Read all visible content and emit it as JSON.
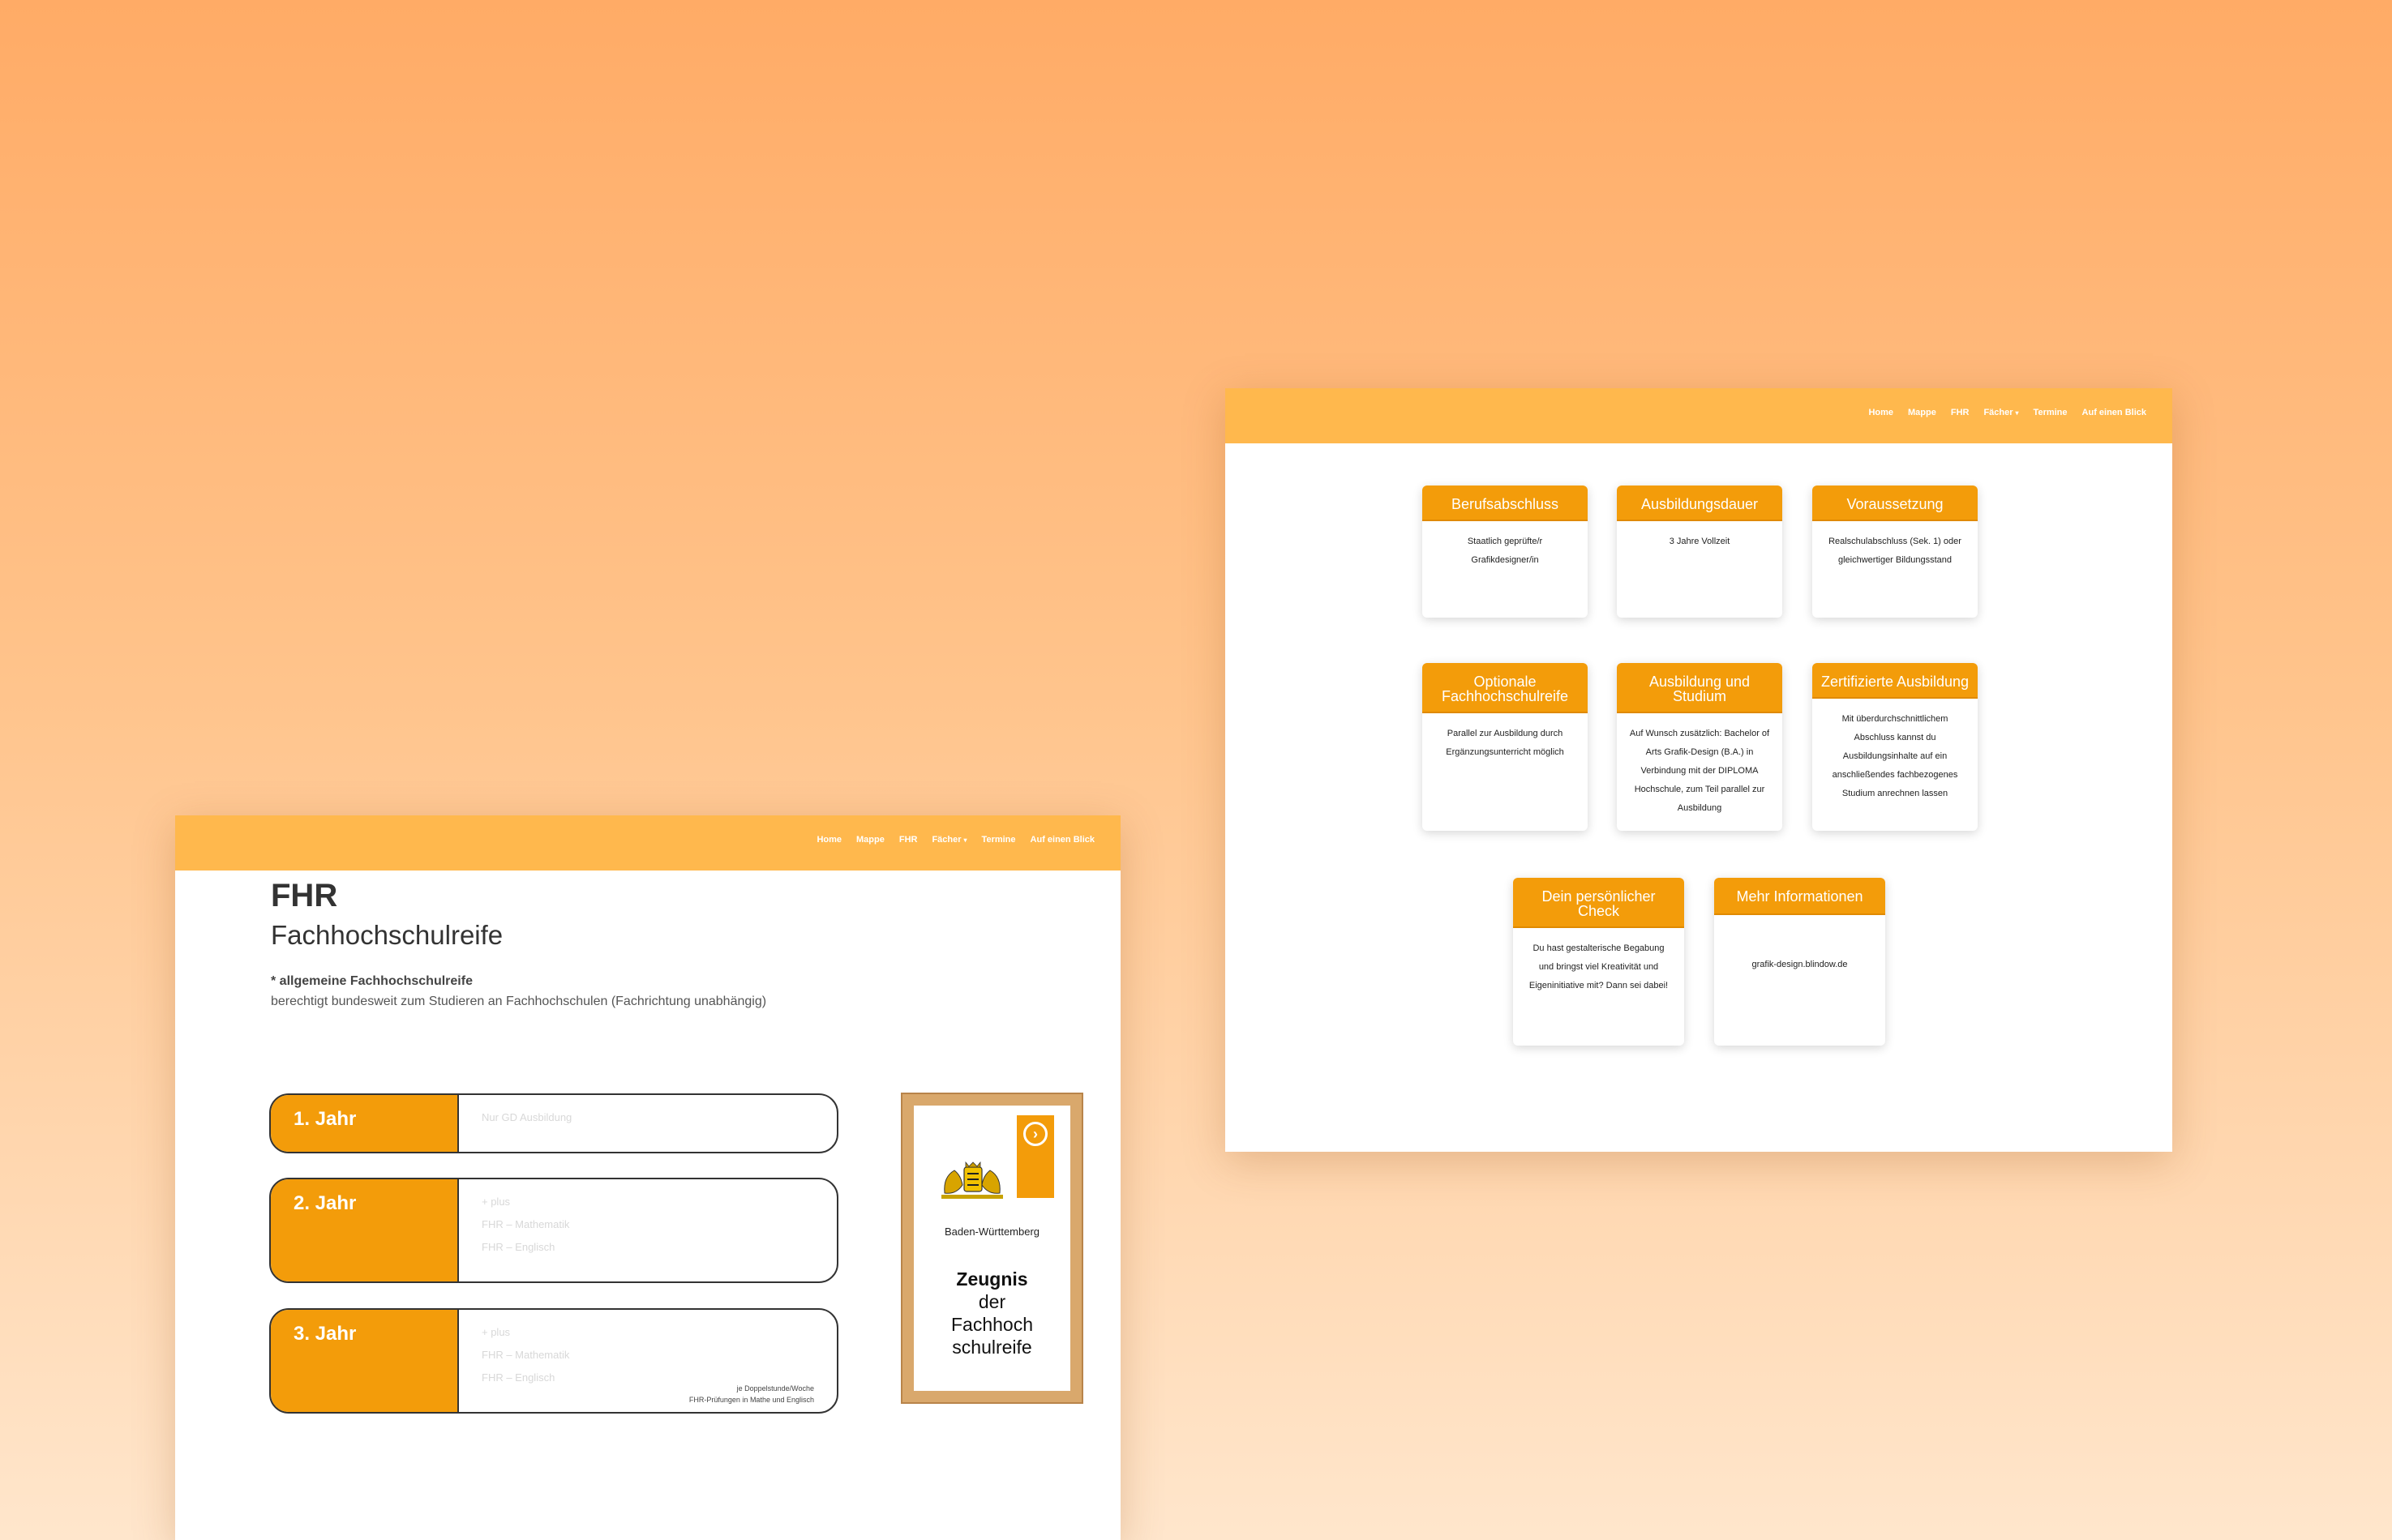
{
  "nav": {
    "items": [
      "Home",
      "Mappe",
      "FHR",
      "Fächer",
      "Termine",
      "Auf einen Blick"
    ],
    "dropdown_caret": "chevron-down"
  },
  "overview_page": {
    "cards": [
      {
        "title": "Berufsabschluss",
        "body": "Staatlich geprüfte/r Grafikdesigner/in"
      },
      {
        "title": "Ausbildungsdauer",
        "body": "3 Jahre Vollzeit"
      },
      {
        "title": "Voraussetzung",
        "body": "Realschulabschluss (Sek. 1) oder gleichwertiger Bildungsstand"
      },
      {
        "title": "Optionale Fachhochschulreife",
        "body": "Parallel zur Ausbildung durch Ergänzungsunterricht möglich"
      },
      {
        "title": "Ausbildung und Studium",
        "body": "Auf Wunsch zusätzlich: Bachelor of Arts Grafik-Design (B.A.) in Verbindung mit der DIPLOMA Hochschule, zum Teil parallel zur Ausbildung"
      },
      {
        "title": "Zertifizierte Ausbildung",
        "body": "Mit überdurchschnittlichem Abschluss kannst du Ausbildungsinhalte auf ein anschließendes fachbezogenes Studium anrechnen lassen"
      },
      {
        "title": "Dein persönlicher Check",
        "body": "Du hast gestalterische Begabung und bringst viel Kreativität und Eigeninitiative mit? Dann sei dabei!"
      },
      {
        "title": "Mehr Informationen",
        "body": "grafik-design.blindow.de"
      }
    ]
  },
  "fhr_page": {
    "title": "FHR",
    "subtitle": "Fachhochschulreife",
    "note": "* allgemeine Fachhochschulreife",
    "description": "berechtigt bundesweit zum Studieren an Fachhochschulen (Fachrichtung unabhängig)",
    "years": [
      {
        "label": "1. Jahr",
        "lines": [
          "Nur GD Ausbildung"
        ]
      },
      {
        "label": "2. Jahr",
        "lines": [
          "+ plus",
          "FHR – Mathematik",
          "FHR – Englisch"
        ]
      },
      {
        "label": "3. Jahr",
        "lines": [
          "+ plus",
          "FHR – Mathematik",
          "FHR – Englisch"
        ]
      }
    ],
    "footnote": [
      "je Doppelstunde/Woche",
      "FHR-Prüfungen in Mathe und Englisch"
    ],
    "certificate": {
      "state": "Baden-Württemberg",
      "title_bold": "Zeugnis",
      "title_lines": [
        "der",
        "Fachhoch",
        "schulreife"
      ]
    }
  },
  "colors": {
    "header": "#ffb84d",
    "accent": "#f39c0a",
    "frame": "#d9a86c"
  }
}
